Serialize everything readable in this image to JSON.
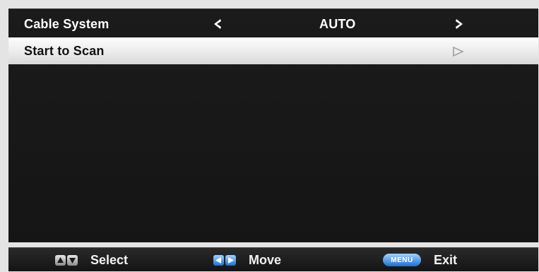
{
  "menu": {
    "cable_system": {
      "label": "Cable System",
      "value": "AUTO",
      "left_arrow_icon": "chevron-left-icon",
      "right_arrow_icon": "chevron-right-icon"
    },
    "start_scan": {
      "label": "Start to Scan",
      "enter_icon": "triangle-right-outline-icon"
    },
    "highlight_color": "#f2f2f2"
  },
  "footer": {
    "select": {
      "icon": "up-down-keys-icon",
      "label": "Select"
    },
    "move": {
      "icon": "left-right-keys-icon",
      "label": "Move"
    },
    "exit": {
      "icon_text": "MENU",
      "label": "Exit"
    }
  }
}
